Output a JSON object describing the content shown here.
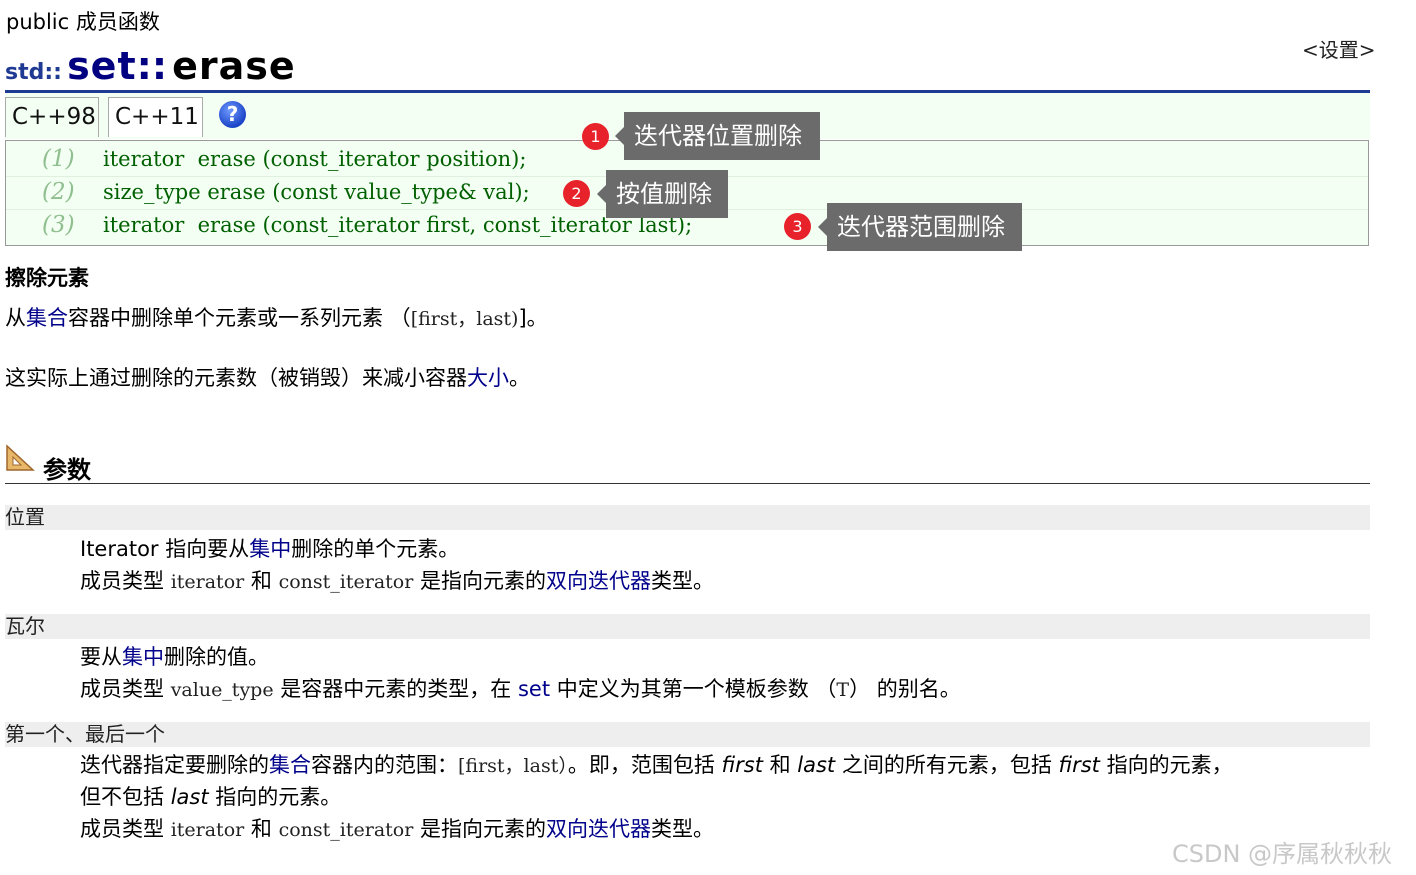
{
  "header": {
    "pretitle": "public 成员函数",
    "settings_link": "<设置>",
    "title_ns": "std::",
    "title_class": "set",
    "title_sep": "::",
    "title_func": "erase"
  },
  "tabs": [
    {
      "label": "C++98"
    },
    {
      "label": "C++11"
    }
  ],
  "help_icon_text": "?",
  "syntax": [
    {
      "num": "(1)",
      "code": "iterator  erase (const_iterator position);"
    },
    {
      "num": "(2)",
      "code": "size_type erase (const value_type& val);"
    },
    {
      "num": "(3)",
      "code": "iterator  erase (const_iterator first, const_iterator last);"
    }
  ],
  "annotations": [
    {
      "marker": "1",
      "text": "迭代器位置删除",
      "color": "#e8222a"
    },
    {
      "marker": "2",
      "text": "按值删除",
      "color": "#e8222a"
    },
    {
      "marker": "3",
      "text": "迭代器范围删除",
      "color": "#e8222a"
    }
  ],
  "description": {
    "heading": "擦除元素",
    "p1": {
      "a": "从",
      "link": "集合",
      "b": "容器中删除单个元素或一系列元素 （",
      "code": "[first，last)",
      "c": "]。"
    },
    "p2": {
      "a": "这实际上通过删除的元素数（被销毁）来减小容器",
      "link": "大小",
      "b": "。"
    }
  },
  "params": {
    "heading": "参数",
    "items": [
      {
        "term": "位置",
        "line1": {
          "a": "Iterator 指向要从",
          "link": "集中",
          "b": "删除的单个元素。"
        },
        "line2": {
          "a": "成员类型 ",
          "code1": "iterator",
          "b": " 和 ",
          "code2": "const_iterator",
          "c": " 是指向元素的",
          "link": "双向迭代器",
          "d": "类型。"
        }
      },
      {
        "term": "瓦尔",
        "line1": {
          "a": "要从",
          "link": "集中",
          "b": "删除的值。"
        },
        "line2": {
          "a": "成员类型 ",
          "code1": "value_type",
          "b": " 是容器中元素的类型，在 ",
          "link": "set",
          "c": " 中定义为其第一个模板参数 （",
          "code2": "T",
          "d": "） 的别名。"
        }
      },
      {
        "term": "第一个、最后一个",
        "line1": {
          "a": "迭代器指定要删除的",
          "link": "集合",
          "b": "容器内的范围：",
          "code": "[first，last）",
          "c": "。即，范围包括 ",
          "em1": "first",
          "d": " 和 ",
          "em2": "last",
          "e": " 之间的所有元素，包括 ",
          "em3": "first",
          "f": " 指向的元素，"
        },
        "line2": {
          "a": "但不包括 ",
          "em": "last",
          "b": " 指向的元素。"
        },
        "line3": {
          "a": "成员类型 ",
          "code1": "iterator",
          "b": " 和 ",
          "code2": "const_iterator",
          "c": " 是指向元素的",
          "link": "双向迭代器",
          "d": "类型。"
        }
      }
    ]
  },
  "watermark": "CSDN @序属秋秋秋",
  "colors": {
    "title_blue": "#1f3a93",
    "link": "#00008b",
    "code_green": "#006000",
    "callout_bg": "#6b6b6b",
    "syntax_bg": "#f3fff3"
  }
}
